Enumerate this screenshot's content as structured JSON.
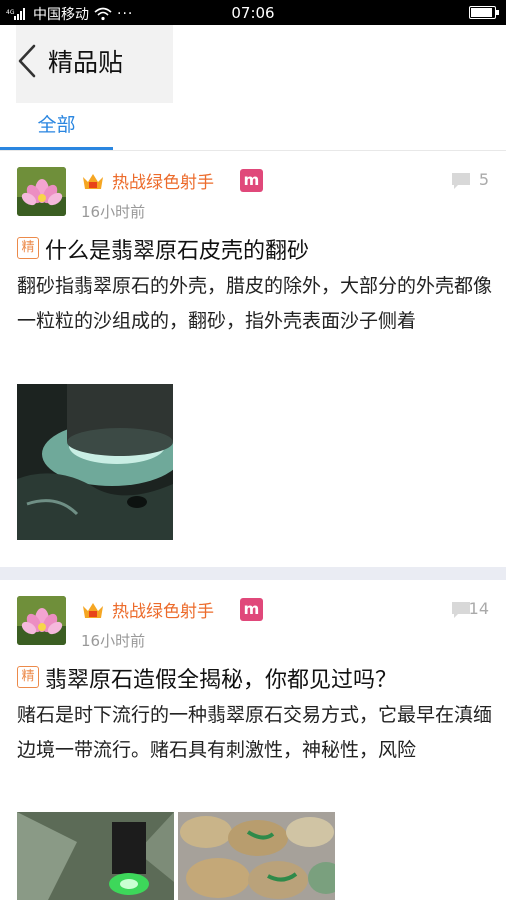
{
  "status_bar": {
    "carrier": "中国移动",
    "time": "07:06",
    "battery_level": 0.95
  },
  "header": {
    "title": "精品贴",
    "back_icon": "chevron-left-icon"
  },
  "tabs": [
    {
      "label": "全部",
      "active": true
    }
  ],
  "colors": {
    "accent": "#2a86e0",
    "username": "#ec6b2b",
    "essence_tag": "#ec8a4a",
    "level_badge": "#e0487a",
    "divider": "#eaecf3"
  },
  "posts": [
    {
      "username": "热战绿色射手",
      "level_badge": "m",
      "time": "16小时前",
      "comment_count": "5",
      "essence_tag": "精",
      "title": "什么是翡翠原石皮壳的翻砂",
      "body": "翻砂指翡翠原石的外壳，腊皮的除外，大部分的外壳都像一粒粒的沙组成的，翻砂，指外壳表面沙子侧着"
    },
    {
      "username": "热战绿色射手",
      "level_badge": "m",
      "time": "16小时前",
      "comment_count": "14",
      "essence_tag": "精",
      "title": "翡翠原石造假全揭秘，你都见过吗？",
      "body": "赌石是时下流行的一种翡翠原石交易方式，它最早在滇缅边境一带流行。赌石具有刺激性，神秘性，风险"
    }
  ]
}
